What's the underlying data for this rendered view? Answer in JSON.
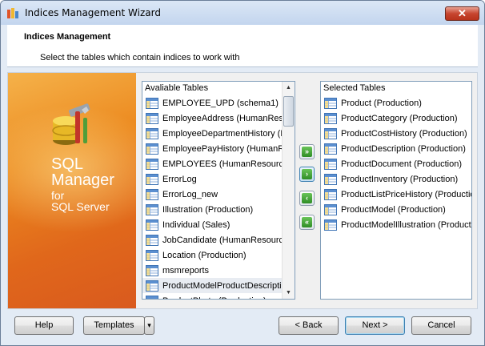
{
  "window": {
    "title": "Indices Management Wizard",
    "close_symbol": "✕"
  },
  "header": {
    "title": "Indices Management",
    "subtitle": "Select the tables which contain indices to work with"
  },
  "banner": {
    "line1": "SQL",
    "line2": "Manager",
    "line3": "for",
    "line4": "SQL Server",
    "logo_icon": "database-tools-icon"
  },
  "available": {
    "header": "Avaliable Tables",
    "items": [
      "EMPLOYEE_UPD (schema1)",
      "EmployeeAddress (HumanResources)",
      "EmployeeDepartmentHistory (HumanResources)",
      "EmployeePayHistory (HumanResources)",
      "EMPLOYEES (HumanResources)",
      "ErrorLog",
      "ErrorLog_new",
      "Illustration (Production)",
      "Individual (Sales)",
      "JobCandidate (HumanResources)",
      "Location (Production)",
      "msmreports",
      "ProductModelProductDescriptionCulture (Production)",
      "ProductPhoto (Production)"
    ],
    "selected_index": 12
  },
  "selected": {
    "header": "Selected Tables",
    "items": [
      "Product (Production)",
      "ProductCategory (Production)",
      "ProductCostHistory (Production)",
      "ProductDescription (Production)",
      "ProductDocument (Production)",
      "ProductInventory (Production)",
      "ProductListPriceHistory (Production)",
      "ProductModel (Production)",
      "ProductModelIllustration (Production)"
    ]
  },
  "move_buttons": {
    "add_all": "»",
    "add": "›",
    "remove": "‹",
    "remove_all": "«"
  },
  "footer": {
    "help": "Help",
    "templates": "Templates",
    "templates_arrow": "▾",
    "back": "< Back",
    "next": "Next >",
    "cancel": "Cancel"
  },
  "colors": {
    "banner_orange": "#ec8a20",
    "move_button_green": "#2f8d25",
    "focus_blue": "#3c7fb1"
  }
}
